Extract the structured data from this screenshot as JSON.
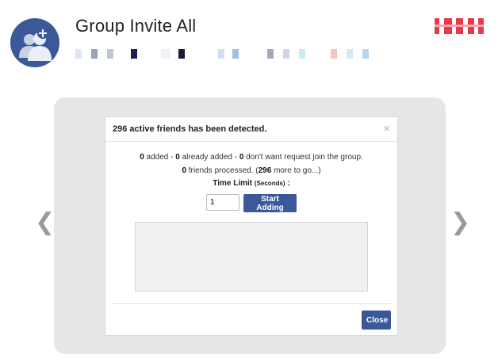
{
  "app": {
    "title": "Group Invite All",
    "logo_icon": "group-add-icon",
    "brand_color": "#3b5998"
  },
  "modal": {
    "title": "296 active friends has been detected.",
    "close_icon": "close-icon",
    "stats": {
      "added": "0",
      "added_label": " added - ",
      "already_added": "0",
      "already_added_label": " already added - ",
      "dont_want": "0",
      "dont_want_label": " don't want request join the group."
    },
    "progress": {
      "processed": "0",
      "processed_label": " friends processed. (",
      "remaining": "296",
      "remaining_label": " more to go...)"
    },
    "time_limit": {
      "label": "Time Limit",
      "unit": "(Seconds)",
      "suffix": ":",
      "value": "1"
    },
    "start_button": "Start Adding",
    "log_text": "",
    "close_button": "Close"
  },
  "navigation": {
    "prev_icon": "chevron-left-icon",
    "next_icon": "chevron-right-icon",
    "prev_glyph": "❮",
    "next_glyph": "❯"
  }
}
